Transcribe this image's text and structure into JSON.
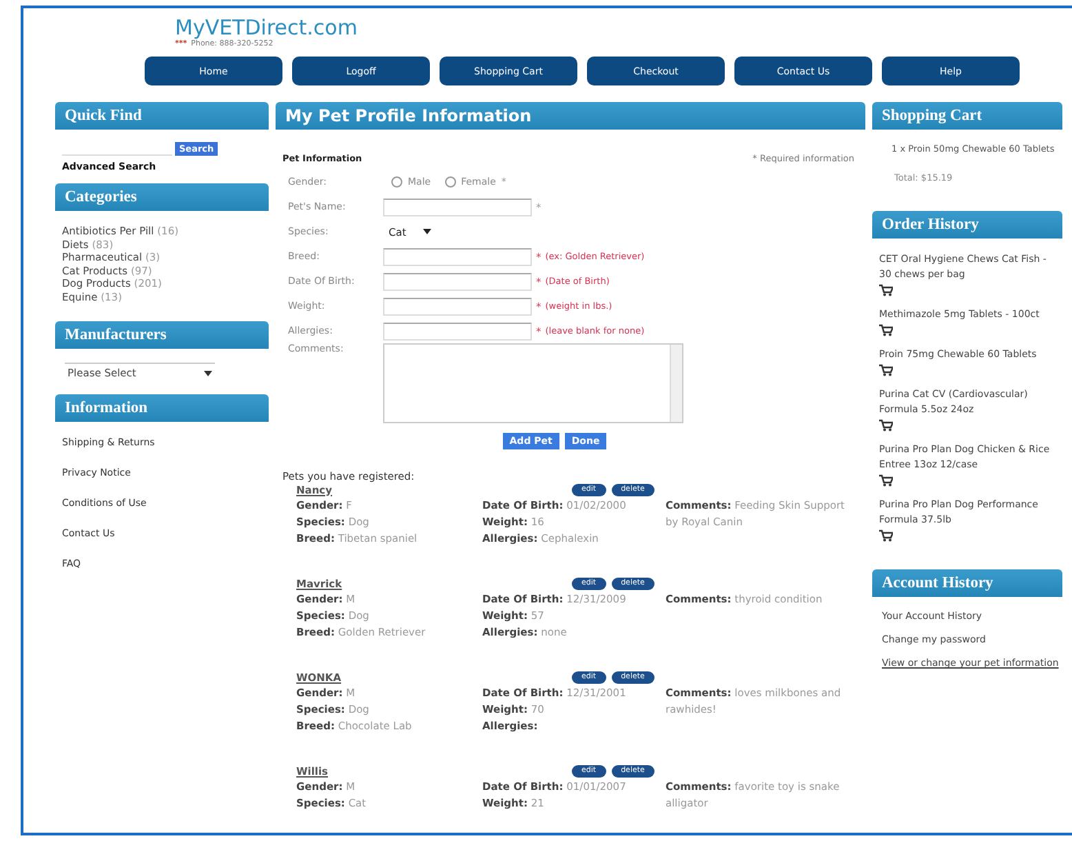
{
  "header": {
    "logo": "MyVETDirect.com",
    "stars": "***",
    "phone": "Phone: 888-320-5252"
  },
  "nav": [
    "Home",
    "Logoff",
    "Shopping Cart",
    "Checkout",
    "Contact Us",
    "Help"
  ],
  "quick_find": {
    "title": "Quick Find",
    "search_button": "Search",
    "advanced_link": "Advanced Search"
  },
  "categories": {
    "title": "Categories",
    "items": [
      {
        "name": "Antibiotics Per Pill",
        "count": "(16)"
      },
      {
        "name": "Diets",
        "count": "(83)"
      },
      {
        "name": "Pharmaceutical",
        "count": "(3)"
      },
      {
        "name": "Cat Products",
        "count": "(97)"
      },
      {
        "name": "Dog Products",
        "count": "(201)"
      },
      {
        "name": "Equine",
        "count": "(13)"
      }
    ]
  },
  "manufacturers": {
    "title": "Manufacturers",
    "select_value": "Please Select"
  },
  "information": {
    "title": "Information",
    "links": [
      "Shipping & Returns",
      "Privacy Notice",
      "Conditions of Use",
      "Contact Us",
      "FAQ"
    ]
  },
  "main": {
    "title": "My Pet Profile Information",
    "form": {
      "section": "Pet Information",
      "required_note": "* Required information",
      "fields": [
        {
          "kind": "radio",
          "label": "Gender:",
          "options": [
            {
              "label": "Male",
              "selected": false
            },
            {
              "label": "Female",
              "selected": false
            }
          ],
          "required": "*"
        },
        {
          "kind": "text",
          "label": "Pet's Name:",
          "required": "*"
        },
        {
          "kind": "select",
          "label": "Species:",
          "value": "Cat"
        },
        {
          "kind": "text",
          "label": "Breed:",
          "required": "*",
          "hint": "(ex: Golden Retriever)"
        },
        {
          "kind": "text",
          "label": "Date Of Birth:",
          "required": "*",
          "hint": "(Date of Birth)"
        },
        {
          "kind": "text",
          "label": "Weight:",
          "required": "*",
          "hint": "(weight in lbs.)"
        },
        {
          "kind": "text",
          "label": "Allergies:",
          "required": "*",
          "hint": "(leave blank for none)"
        },
        {
          "kind": "textarea",
          "label": "Comments:"
        }
      ],
      "buttons": [
        "Add Pet",
        "Done"
      ]
    },
    "pets_heading": "Pets you have registered:",
    "pets": [
      {
        "name": "Nancy",
        "actions": [
          "edit",
          "delete"
        ],
        "column_1": [
          {
            "label": "Gender:",
            "value": "F"
          },
          {
            "label": "Species:",
            "value": "Dog"
          },
          {
            "label": "Breed:",
            "value": "Tibetan spaniel"
          }
        ],
        "column_2": [
          {
            "label": "Date Of Birth:",
            "value": "01/02/2000"
          },
          {
            "label": "Weight:",
            "value": "16"
          },
          {
            "label": "Allergies:",
            "value": "Cephalexin"
          }
        ],
        "comments": {
          "label": "Comments:",
          "value": "Feeding Skin Support by Royal Canin"
        }
      },
      {
        "name": "Mavrick",
        "actions": [
          "edit",
          "delete"
        ],
        "column_1": [
          {
            "label": "Gender:",
            "value": "M"
          },
          {
            "label": "Species:",
            "value": "Dog"
          },
          {
            "label": "Breed:",
            "value": "Golden Retriever"
          }
        ],
        "column_2": [
          {
            "label": "Date Of Birth:",
            "value": "12/31/2009"
          },
          {
            "label": "Weight:",
            "value": "57"
          },
          {
            "label": "Allergies:",
            "value": "none"
          }
        ],
        "comments": {
          "label": "Comments:",
          "value": "thyroid condition"
        }
      },
      {
        "name": "WONKA",
        "actions": [
          "edit",
          "delete"
        ],
        "column_1": [
          {
            "label": "Gender:",
            "value": "M"
          },
          {
            "label": "Species:",
            "value": "Dog"
          },
          {
            "label": "Breed:",
            "value": "Chocolate Lab"
          }
        ],
        "column_2": [
          {
            "label": "Date Of Birth:",
            "value": "12/31/2001"
          },
          {
            "label": "Weight:",
            "value": "70"
          },
          {
            "label": "Allergies:"
          }
        ],
        "comments": {
          "label": "Comments:",
          "value": "loves milkbones and rawhides!"
        }
      },
      {
        "name": "Willis",
        "actions": [
          "edit",
          "delete"
        ],
        "column_1": [
          {
            "label": "Gender:",
            "value": "M"
          },
          {
            "label": "Species:",
            "value": "Cat"
          }
        ],
        "column_2": [
          {
            "label": "Date Of Birth:",
            "value": "01/01/2007"
          },
          {
            "label": "Weight:",
            "value": "21"
          }
        ],
        "comments": {
          "label": "Comments:",
          "value": "favorite toy is snake alligator"
        }
      }
    ]
  },
  "cart": {
    "title": "Shopping Cart",
    "items": [
      "1 x Proin 50mg Chewable 60 Tablets"
    ],
    "total": "Total: $15.19"
  },
  "order_history": {
    "title": "Order History",
    "items": [
      "CET Oral Hygiene Chews Cat Fish - 30 chews per bag",
      "Methimazole 5mg Tablets - 100ct",
      "Proin 75mg Chewable 60 Tablets",
      "Purina Cat CV (Cardiovascular) Formula 5.5oz 24oz",
      "Purina Pro Plan Dog Chicken & Rice Entree 13oz 12/case",
      "Purina Pro Plan Dog Performance Formula 37.5lb"
    ]
  },
  "account": {
    "title": "Account History",
    "links": [
      {
        "label": "Your Account History",
        "underlined": false
      },
      {
        "label": "Change my password",
        "underlined": false
      },
      {
        "label": "View or change your pet information",
        "underlined": true
      }
    ]
  }
}
